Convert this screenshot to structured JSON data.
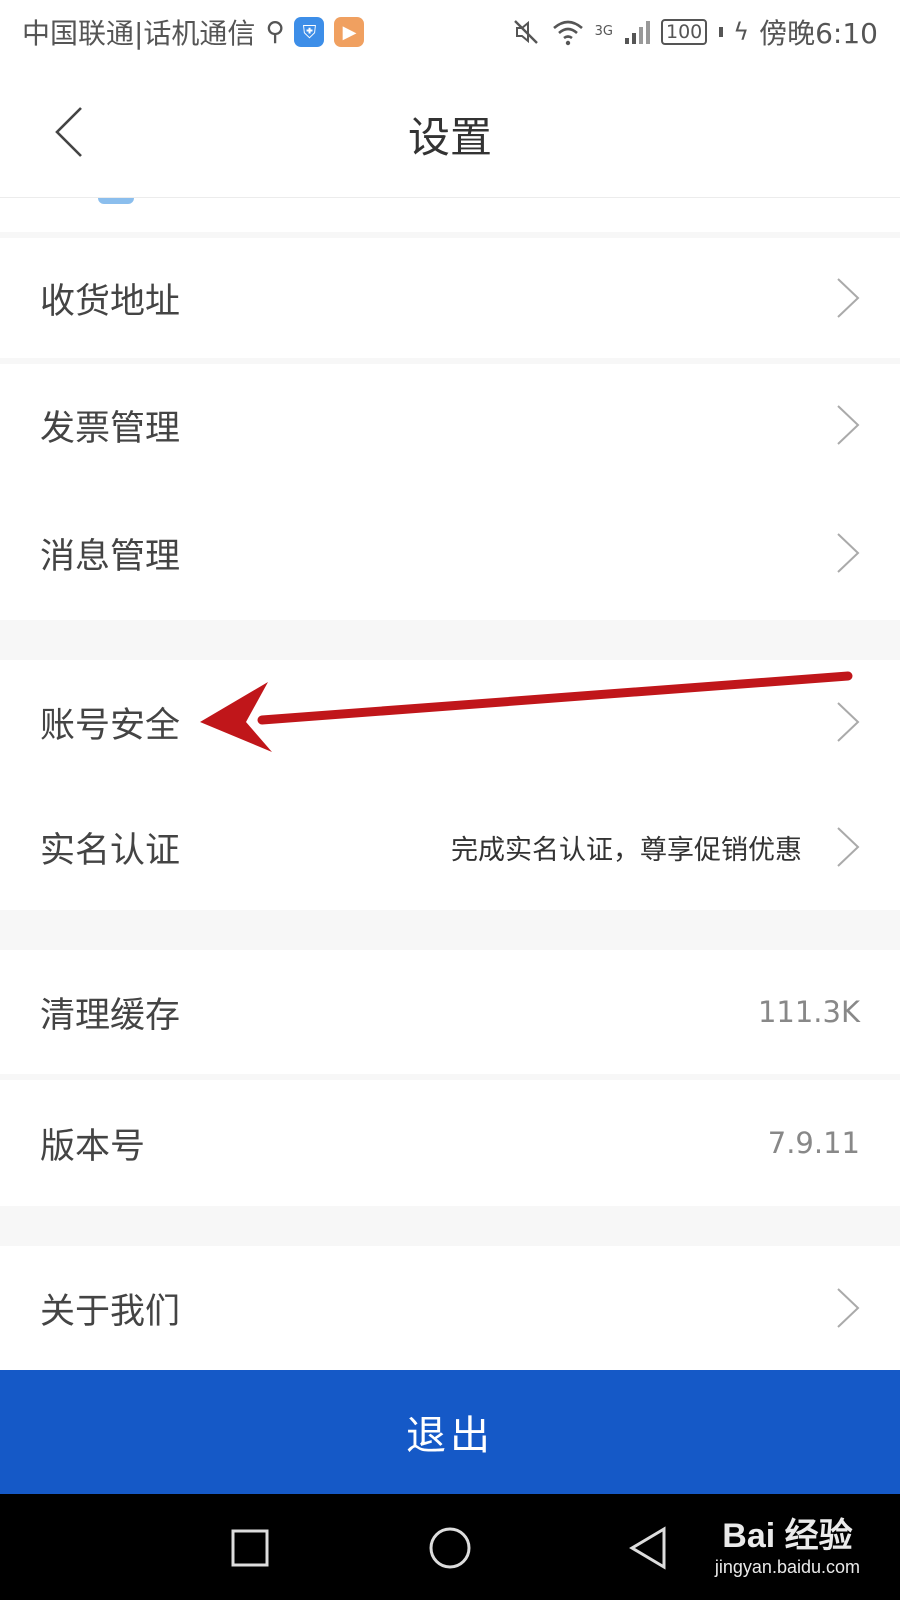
{
  "status_bar": {
    "carrier": "中国联通|话机通信",
    "usb_icon": "usb-icon",
    "app_icons": [
      "shield-app-icon",
      "video-app-icon"
    ],
    "battery": "100",
    "time": "傍晚6:10",
    "network": "3G"
  },
  "header": {
    "title": "设置",
    "back_icon": "chevron-left-icon"
  },
  "settings": {
    "shipping_address": "收货地址",
    "invoice_management": "发票管理",
    "message_management": "消息管理",
    "account_security": "账号安全",
    "real_name_auth": "实名认证",
    "real_name_hint": "完成实名认证，尊享促销优惠",
    "clear_cache": "清理缓存",
    "cache_size": "111.3K",
    "version_label": "版本号",
    "version_value": "7.9.11",
    "about_us": "关于我们"
  },
  "logout": {
    "label": "退出",
    "color": "#1559c7"
  },
  "annotation": {
    "arrow_color": "#c0161a"
  },
  "watermark": {
    "logo": "Bai 经验",
    "url": "jingyan.baidu.com"
  }
}
